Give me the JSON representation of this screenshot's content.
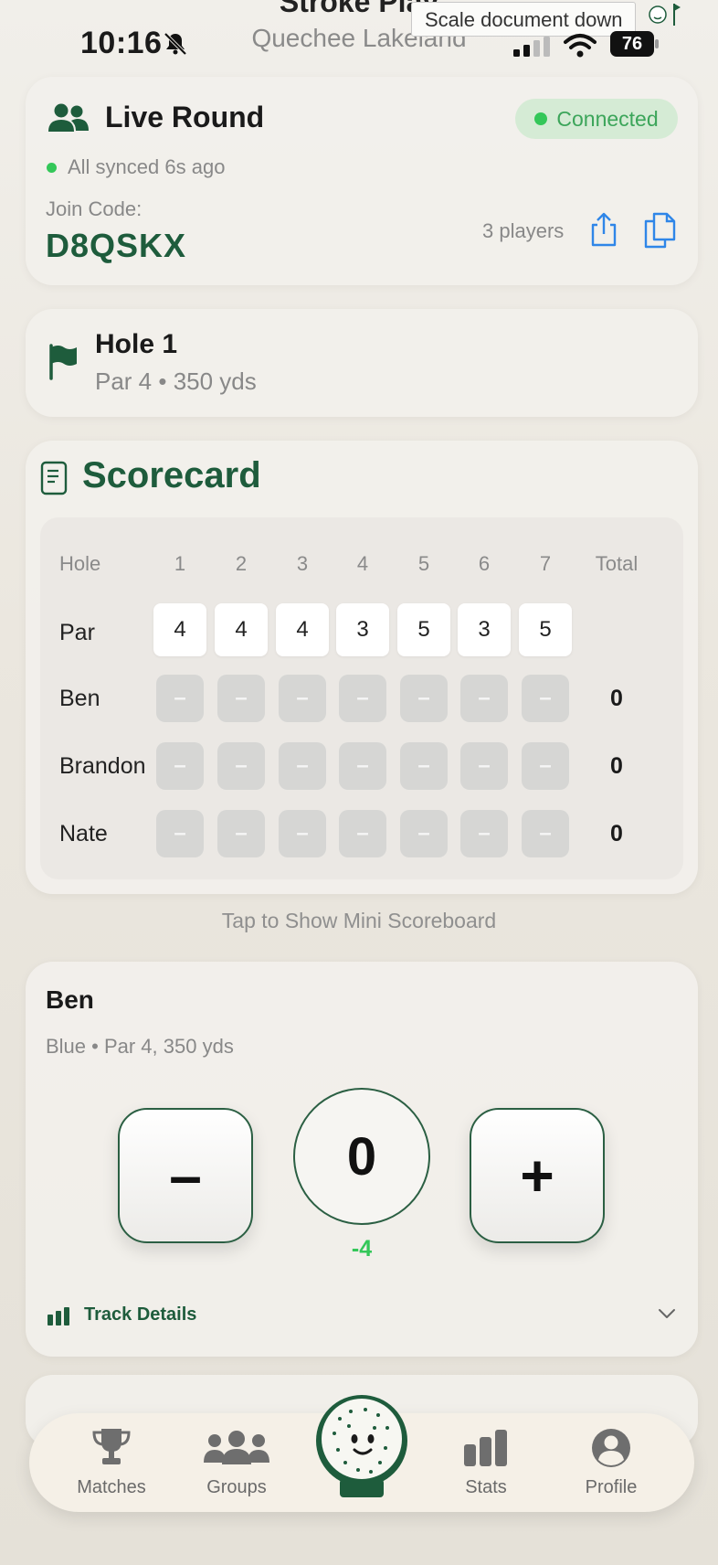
{
  "status_bar": {
    "time": "10:16",
    "battery": "76"
  },
  "nav": {
    "title": "Stroke Play",
    "subtitle": "Quechee Lakeland"
  },
  "tooltip": "Scale document down",
  "live_round": {
    "title": "Live Round",
    "status": "Connected",
    "sync_text": "All synced 6s ago",
    "join_label": "Join Code:",
    "join_code": "D8QSKX",
    "players": "3 players"
  },
  "hole": {
    "title": "Hole 1",
    "subtitle": "Par 4 • 350 yds"
  },
  "scorecard": {
    "title": "Scorecard",
    "hole_header": "Hole",
    "holes": [
      "1",
      "2",
      "3",
      "4",
      "5",
      "6",
      "7"
    ],
    "total_header": "Total",
    "par_label": "Par",
    "pars": [
      "4",
      "4",
      "4",
      "3",
      "5",
      "3",
      "5"
    ],
    "players": [
      {
        "name": "Ben",
        "scores": [
          "–",
          "–",
          "–",
          "–",
          "–",
          "–",
          "–"
        ],
        "total": "0"
      },
      {
        "name": "Brandon",
        "scores": [
          "–",
          "–",
          "–",
          "–",
          "–",
          "–",
          "–"
        ],
        "total": "0"
      },
      {
        "name": "Nate",
        "scores": [
          "–",
          "–",
          "–",
          "–",
          "–",
          "–",
          "–"
        ],
        "total": "0"
      }
    ]
  },
  "mini_scoreboard_link": "Tap to Show Mini Scoreboard",
  "player_entry": {
    "name": "Ben",
    "subtitle": "Blue • Par 4, 350 yds",
    "score": "0",
    "to_par": "-4",
    "minus_label": "–",
    "plus_label": "+",
    "track_details": "Track Details"
  },
  "tab_bar": {
    "items": [
      {
        "label": "Matches",
        "icon": "trophy-icon"
      },
      {
        "label": "Groups",
        "icon": "people-icon"
      },
      {
        "label": "",
        "icon": "golf-ball-mascot-icon"
      },
      {
        "label": "Stats",
        "icon": "bar-chart-icon"
      },
      {
        "label": "Profile",
        "icon": "profile-icon"
      }
    ]
  },
  "colors": {
    "brand_green": "#1e5c3c",
    "success_green": "#34c759",
    "background": "#ebe7df"
  }
}
